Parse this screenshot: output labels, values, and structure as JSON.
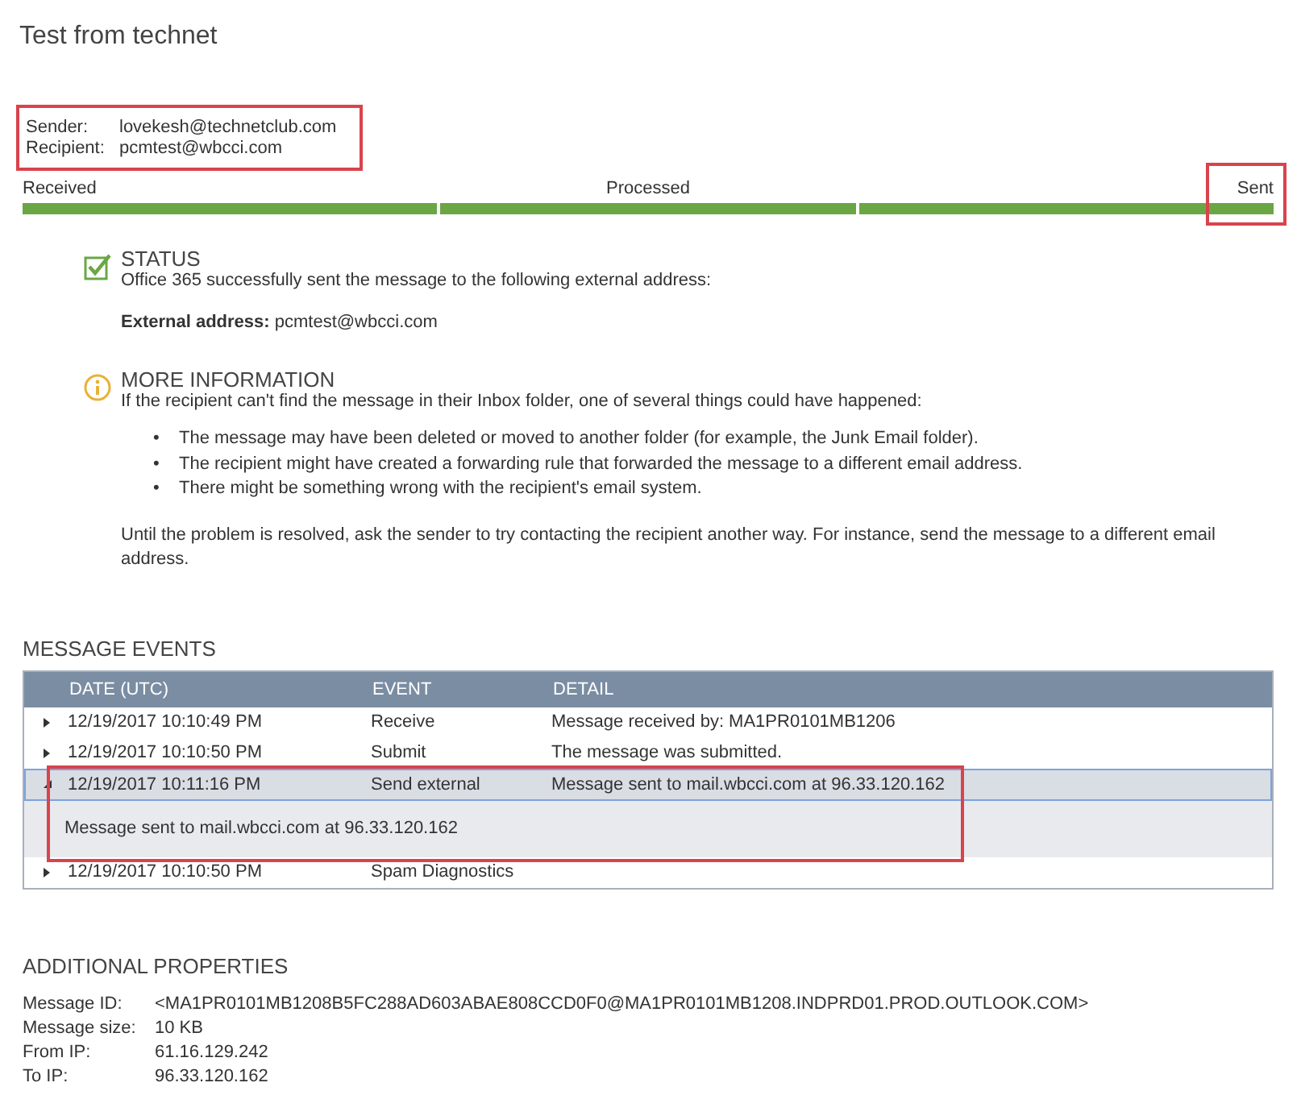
{
  "title": "Test from technet",
  "summary": {
    "highlighted": true,
    "fields": [
      {
        "label": "Sender:",
        "value": "lovekesh@technetclub.com"
      },
      {
        "label": "Recipient:",
        "value": "pcmtest@wbcci.com"
      }
    ]
  },
  "progress": {
    "stages": [
      {
        "label": "Received",
        "highlighted": false
      },
      {
        "label": "Processed",
        "highlighted": false
      },
      {
        "label": "Sent",
        "highlighted": true
      }
    ]
  },
  "notices": [
    {
      "kind": "status",
      "heading": "STATUS",
      "text": "Office 365 successfully sent the message to the following external address:",
      "detail": "**External address:** pcmtest@wbcci.com"
    },
    {
      "kind": "info",
      "heading": "MORE INFORMATION",
      "text": "If the recipient can't find the message in their Inbox folder, one of several things could have happened:",
      "bullets": [
        {
          "marker": "•",
          "text": "The message may have been deleted or moved to another folder (for example, the Junk Email folder)."
        },
        {
          "marker": "•",
          "text": "The recipient might have created a forwarding rule that forwarded the message to a different email address."
        },
        {
          "marker": "•",
          "text": "There might be something wrong with the recipient's email system."
        }
      ],
      "footer": "Until the problem is resolved, ask the sender to try contacting the recipient another way. For instance, send the message to a different email address."
    }
  ],
  "events": {
    "heading": "MESSAGE EVENTS",
    "columns": [
      "DATE (UTC)",
      "EVENT",
      "DETAIL"
    ],
    "rows": [
      {
        "date": "12/19/2017 10:10:49 PM",
        "event": "Receive",
        "detail": "Message received by: MA1PR0101MB1206",
        "expanded": false,
        "highlighted": false
      },
      {
        "date": "12/19/2017 10:10:50 PM",
        "event": "Submit",
        "detail": "The message was submitted.",
        "expanded": false,
        "highlighted": false
      },
      {
        "date": "12/19/2017 10:11:16 PM",
        "event": "Send external",
        "detail": "Message sent to mail.wbcci.com at 96.33.120.162",
        "expanded": true,
        "highlighted": true,
        "expansion": "Message sent to mail.wbcci.com at 96.33.120.162"
      },
      {
        "date": "12/19/2017 10:10:50 PM",
        "event": "Spam Diagnostics",
        "expanded": false,
        "highlighted": false
      }
    ]
  },
  "properties": {
    "heading": "ADDITIONAL PROPERTIES",
    "items": [
      {
        "label": "Message ID:",
        "value": "<MA1PR0101MB1208B5FC288AD603ABAE808CCD0F0@MA1PR0101MB1208.INDPRD01.PROD.OUTLOOK.COM>"
      },
      {
        "label": "Message size:",
        "value": "10 KB"
      },
      {
        "label": "From IP:",
        "value": "61.16.129.242"
      },
      {
        "label": "To IP:",
        "value": "96.33.120.162"
      }
    ]
  }
}
